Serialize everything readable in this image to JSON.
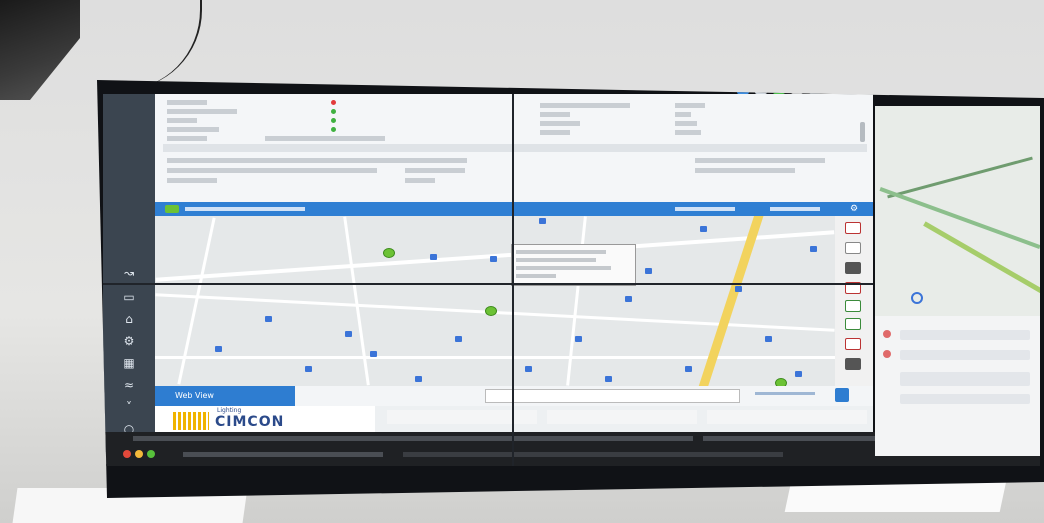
{
  "brand": {
    "logo_text": "CIMCON",
    "logo_caption": "Lighting",
    "logo_color": "#2b4a8a",
    "accent_yellow": "#f0b400"
  },
  "app": {
    "accent": "#2f7fd3",
    "web_view_label": "Web View",
    "sidebar_icons": [
      "chevron-right-icon",
      "circle-icon",
      "wave-icon",
      "settings-icon",
      "globe-icon",
      "signal-icon",
      "chart-icon",
      "link-icon"
    ]
  },
  "colors": {
    "status_red": "#e23b3b",
    "status_green": "#3fb13f",
    "map_node": "#6cc235",
    "map_poi": "#3b74d8",
    "highway": "#f2d35e"
  }
}
